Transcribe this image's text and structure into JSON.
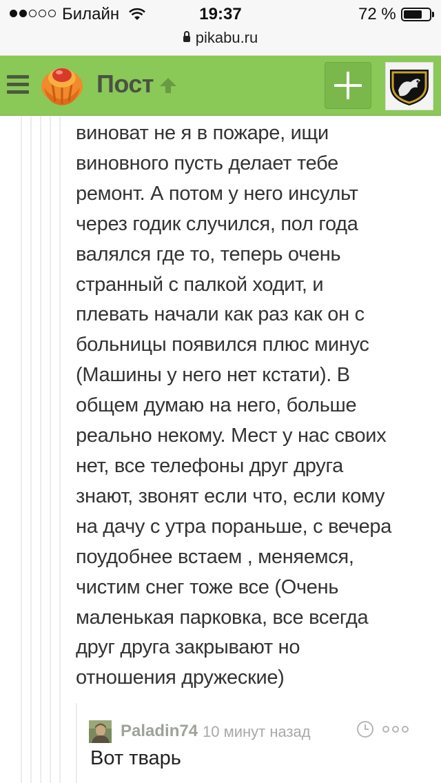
{
  "status_bar": {
    "carrier": "Билайн",
    "time": "19:37",
    "battery_percent": "72 %",
    "battery_level": 0.72,
    "signal_bars_filled": 2,
    "signal_bars_total": 5
  },
  "browser": {
    "url": "pikabu.ru"
  },
  "header": {
    "title": "Пост",
    "accent_color": "#8ac858"
  },
  "comment": {
    "lines": [
      "виноват не я в пожаре, ищи",
      "виновного пусть делает тебе",
      "ремонт. А потом у него инсульт",
      "через годик случился, пол года",
      "валялся где то, теперь очень",
      "странный с палкой ходит, и",
      "плевать начали как раз как он с",
      "больницы появился плюс минус",
      "(Машины у него нет кстати). В",
      "общем думаю на него, больше",
      "реально некому. Мест у нас своих",
      "нет, все телефоны друг друга",
      "знают, звонят если что, если кому",
      "на дачу с утра пораньше, с вечера",
      "поудобнее встаем , меняемся,",
      "чистим снег тоже все (Очень",
      "маленькая парковка, все всегда",
      "друг друга закрывают но",
      "отношения дружеские)"
    ]
  },
  "reply": {
    "author": "Paladin74",
    "time": "10 минут назад",
    "text": "Вот тварь"
  }
}
